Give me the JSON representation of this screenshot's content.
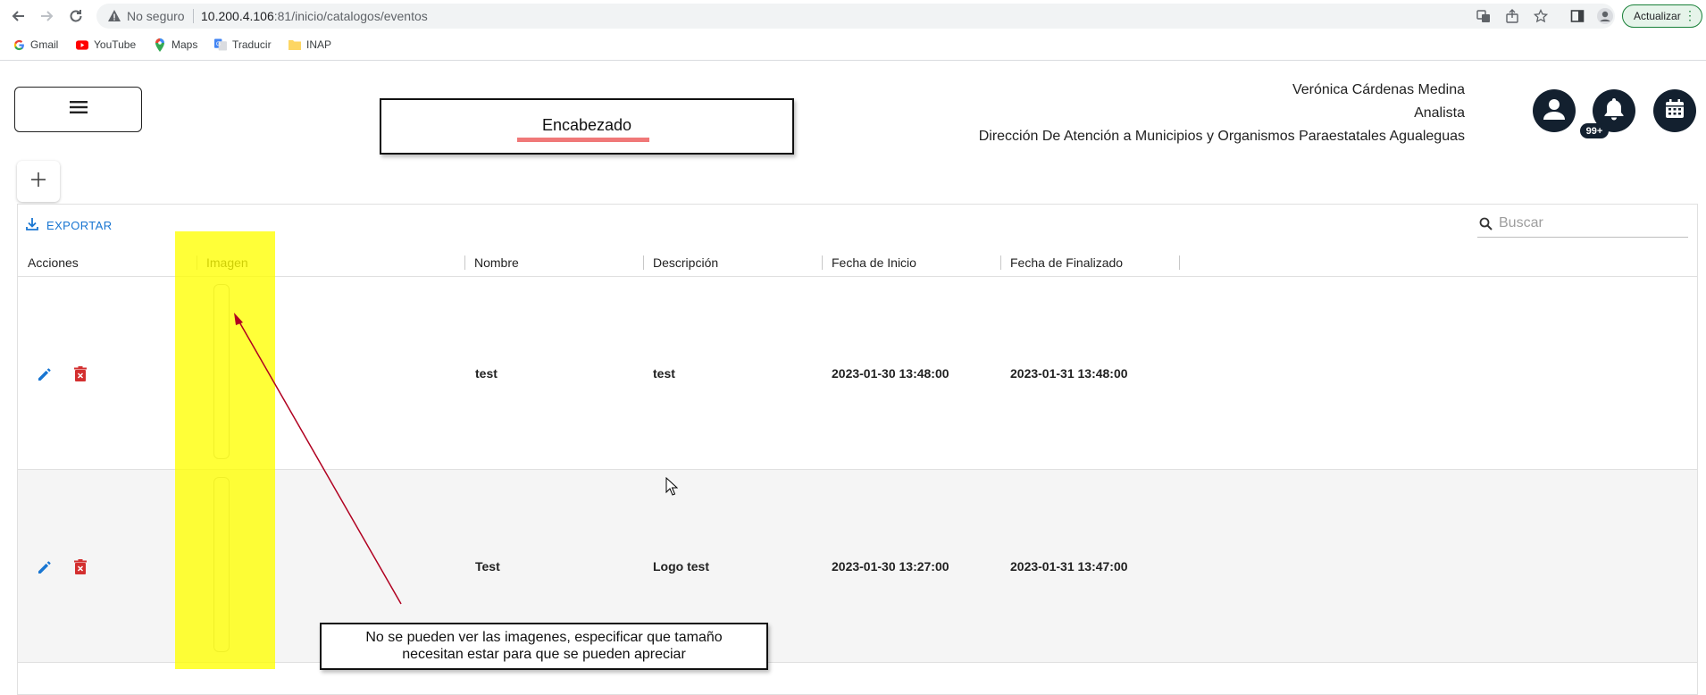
{
  "browser": {
    "not_secure_label": "No seguro",
    "url_host": "10.200.4.106",
    "url_rest": ":81/inicio/catalogos/eventos",
    "update_label": "Actualizar",
    "bookmarks": [
      {
        "label": "Gmail",
        "icon": "google-icon"
      },
      {
        "label": "YouTube",
        "icon": "youtube-icon"
      },
      {
        "label": "Maps",
        "icon": "maps-icon"
      },
      {
        "label": "Traducir",
        "icon": "translate-icon"
      },
      {
        "label": "INAP",
        "icon": "folder-icon"
      }
    ]
  },
  "header": {
    "title": "Encabezado",
    "user_name": "Verónica Cárdenas Medina",
    "user_role": "Analista",
    "user_department": "Dirección De Atención a Municipios y Organismos Paraestatales Agualeguas",
    "notification_badge": "99+"
  },
  "grid": {
    "export_label": "EXPORTAR",
    "search_placeholder": "Buscar",
    "columns": [
      "Acciones",
      "Imagen",
      "Nombre",
      "Descripción",
      "Fecha de Inicio",
      "Fecha de Finalizado"
    ],
    "rows": [
      {
        "nombre": "test",
        "descripcion": "test",
        "fecha_inicio": "2023-01-30 13:48:00",
        "fecha_fin": "2023-01-31 13:48:00"
      },
      {
        "nombre": "Test",
        "descripcion": "Logo test",
        "fecha_inicio": "2023-01-30 13:27:00",
        "fecha_fin": "2023-01-31 13:47:00"
      }
    ]
  },
  "annotation": {
    "note_line1": "No se pueden ver las imagenes, especificar que tamaño",
    "note_line2": "necesitan estar para que se pueden apreciar",
    "highlight_color": "#ffff00",
    "arrow_color": "#b00020"
  },
  "colors": {
    "accent": "#1976d2",
    "delete": "#d32f2f",
    "dark_button": "#13202f"
  }
}
